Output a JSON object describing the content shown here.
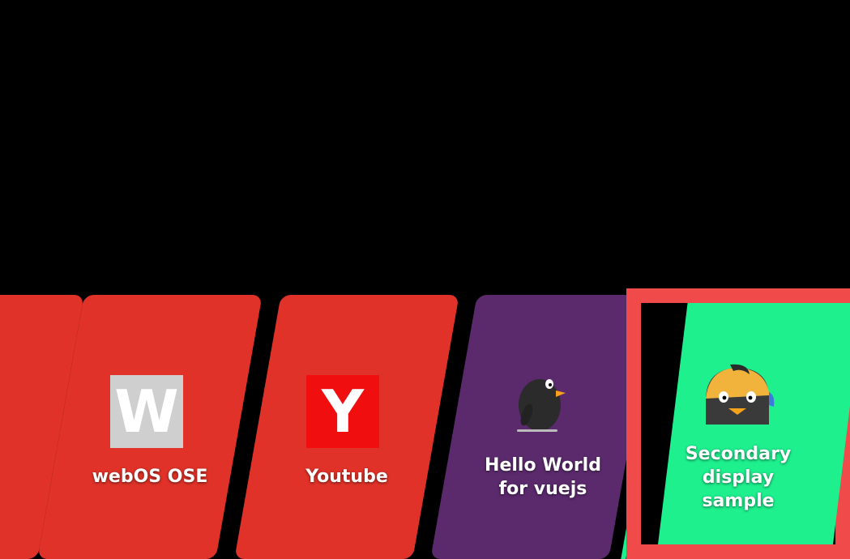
{
  "launcher": {
    "apps": [
      {
        "id": "partial",
        "label": "",
        "color": "#e03228"
      },
      {
        "id": "webos-ose",
        "label": "webOS OSE",
        "color": "#e03228",
        "icon_letter": "W",
        "icon_bg": "#cfcfcf",
        "icon_name": "webos-w-icon"
      },
      {
        "id": "youtube",
        "label": "Youtube",
        "color": "#e03228",
        "icon_letter": "Y",
        "icon_bg": "#f00e0e",
        "icon_name": "youtube-y-icon"
      },
      {
        "id": "hello-world-vuejs",
        "label_line1": "Hello World",
        "label_line2": "for vuejs",
        "color": "#5b2a6d",
        "icon_name": "penguin-icon"
      },
      {
        "id": "secondary-display-sample",
        "label_line1": "Secondary",
        "label_line2": "display",
        "label_line3": "sample",
        "color": "#1ef08e",
        "icon_name": "penguin-cap-icon",
        "focused": true
      }
    ],
    "focus_color": "#f14a4a"
  }
}
